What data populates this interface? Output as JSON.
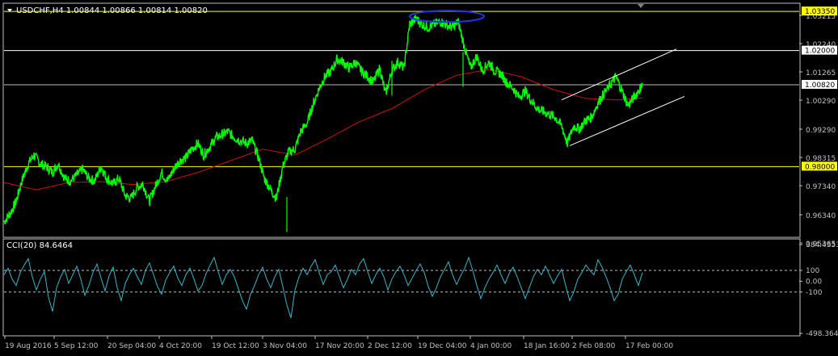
{
  "chart_data": [
    {
      "type": "candlestick-line",
      "title": "USDCHF,H4  1.00844 1.00866 1.00814 1.00820",
      "x_tick_labels": [
        "19 Aug 2016",
        "5 Sep 12:00",
        "20 Sep 04:00",
        "4 Oct 20:00",
        "19 Oct 12:00",
        "3 Nov 04:00",
        "17 Nov 20:00",
        "2 Dec 12:00",
        "19 Dec 04:00",
        "4 Jan 00:00",
        "18 Jan 16:00",
        "2 Feb 08:00",
        "17 Feb 00:00"
      ],
      "y_tick_labels": [
        "1.03215",
        "1.02240",
        "1.01265",
        "1.00290",
        "0.99290",
        "0.98315",
        "0.97340",
        "0.96340",
        "0.95365"
      ],
      "ylim": [
        0.95365,
        1.03215
      ],
      "price_series": {
        "name": "USDCHF",
        "color": "#00ff00",
        "x": [
          0,
          8,
          15,
          22,
          30,
          37,
          45,
          52,
          60,
          67,
          75,
          82,
          90,
          97,
          105,
          112,
          120,
          127,
          135,
          142,
          150,
          157,
          165,
          172,
          180,
          187,
          195,
          202,
          210,
          217,
          225,
          232,
          240,
          247,
          255,
          262,
          270,
          277,
          285,
          292,
          300,
          307,
          315,
          322,
          330,
          337,
          345,
          352,
          360,
          367,
          375,
          382,
          390,
          397,
          405,
          412,
          420,
          427,
          435,
          442,
          450,
          457,
          465,
          472,
          480,
          487,
          495,
          502,
          510,
          517,
          525,
          532,
          540,
          547,
          555,
          562,
          570,
          577,
          585,
          592,
          600,
          607,
          615,
          622,
          630,
          637,
          645,
          652,
          660,
          667,
          675,
          682,
          690,
          697,
          705,
          712,
          720,
          727,
          735,
          742,
          750,
          757,
          765,
          772,
          780,
          787,
          790
        ],
        "values": [
          0.961,
          0.964,
          0.968,
          0.975,
          0.981,
          0.984,
          0.981,
          0.98,
          0.978,
          0.981,
          0.976,
          0.975,
          0.977,
          0.979,
          0.976,
          0.975,
          0.98,
          0.976,
          0.974,
          0.976,
          0.97,
          0.969,
          0.973,
          0.974,
          0.968,
          0.973,
          0.978,
          0.975,
          0.979,
          0.982,
          0.983,
          0.986,
          0.988,
          0.984,
          0.987,
          0.99,
          0.991,
          0.992,
          0.99,
          0.989,
          0.988,
          0.989,
          0.983,
          0.976,
          0.972,
          0.969,
          0.98,
          0.985,
          0.986,
          0.992,
          0.995,
          1.001,
          1.007,
          1.011,
          1.013,
          1.017,
          1.016,
          1.014,
          1.016,
          1.013,
          1.011,
          1.009,
          1.014,
          1.005,
          1.013,
          1.016,
          1.014,
          1.029,
          1.031,
          1.029,
          1.028,
          1.029,
          1.03,
          1.029,
          1.028,
          1.03,
          1.021,
          1.014,
          1.018,
          1.013,
          1.016,
          1.013,
          1.012,
          1.009,
          1.007,
          1.004,
          1.006,
          1.003,
          1.0,
          0.999,
          0.998,
          0.997,
          0.994,
          0.988,
          0.994,
          0.993,
          0.996,
          0.997,
          1.002,
          1.005,
          1.008,
          1.011,
          1.006,
          1.001,
          1.004,
          1.007,
          1.008
        ]
      },
      "ma_series": {
        "name": "",
        "color": "#cc1111",
        "x": [
          0,
          40,
          80,
          120,
          160,
          200,
          240,
          280,
          320,
          360,
          400,
          440,
          480,
          520,
          560,
          600,
          640,
          680,
          720,
          760,
          790
        ],
        "values": [
          0.9745,
          0.972,
          0.9745,
          0.9748,
          0.9738,
          0.9748,
          0.978,
          0.982,
          0.986,
          0.984,
          0.9895,
          0.9955,
          1.0,
          1.0065,
          1.0115,
          1.0135,
          1.011,
          1.0065,
          1.0035,
          1.003,
          1.0037
        ]
      },
      "horizontal_levels": [
        {
          "value": 1.0335,
          "label": "1.03350",
          "color": "#ffff00"
        },
        {
          "value": 1.02,
          "label": "1.02000",
          "color": "#ffffff"
        },
        {
          "value": 1.0082,
          "label": "1.00820",
          "color": "#bbbbbb"
        },
        {
          "value": 0.98,
          "label": "0.98000",
          "color": "#ffff00"
        }
      ],
      "channel_lines": [
        {
          "x1": 690,
          "y1": 1.003,
          "x2": 832,
          "y2": 1.0205,
          "color": "#ffffff"
        },
        {
          "x1": 700,
          "y1": 0.9872,
          "x2": 842,
          "y2": 1.0042,
          "color": "#ffffff"
        }
      ],
      "ellipse_annotation": {
        "cx": 548,
        "cy": 1.0318,
        "rx": 46,
        "ry": 0.0012,
        "color": "#2233ff"
      },
      "grid": false
    },
    {
      "type": "line",
      "title": "CCI(20) 84.6464",
      "y_tick_labels": [
        "384.4353",
        "100",
        "0.00",
        "-100",
        "-498.3641"
      ],
      "ylim": [
        -498.3641,
        384.4353
      ],
      "reference_levels": [
        100,
        -100
      ],
      "series": [
        {
          "name": "CCI(20)",
          "color": "#38b6c8",
          "values": [
            60,
            120,
            20,
            -40,
            80,
            150,
            210,
            40,
            -80,
            20,
            90,
            -150,
            -280,
            -60,
            40,
            110,
            -20,
            60,
            140,
            20,
            -130,
            -40,
            80,
            160,
            30,
            -90,
            50,
            130,
            -60,
            -180,
            -20,
            60,
            120,
            40,
            -30,
            100,
            170,
            60,
            -50,
            -120,
            10,
            80,
            140,
            30,
            -40,
            60,
            120,
            20,
            -90,
            -40,
            70,
            150,
            220,
            90,
            -30,
            60,
            110,
            40,
            -70,
            -180,
            -260,
            -120,
            -40,
            60,
            130,
            20,
            -60,
            40,
            110,
            -50,
            -220,
            -340,
            -80,
            40,
            120,
            60,
            140,
            200,
            80,
            -30,
            60,
            90,
            150,
            40,
            -60,
            20,
            110,
            60,
            160,
            210,
            90,
            -20,
            60,
            120,
            40,
            -80,
            20,
            90,
            140,
            60,
            -40,
            30,
            100,
            160,
            80,
            -50,
            -140,
            -60,
            40,
            110,
            180,
            60,
            -30,
            50,
            120,
            220,
            100,
            -40,
            -160,
            -60,
            20,
            80,
            150,
            60,
            -20,
            70,
            130,
            40,
            -60,
            -160,
            -60,
            40,
            110,
            60,
            140,
            60,
            -20,
            50,
            110,
            -40,
            -180,
            -100,
            20,
            80,
            150,
            100,
            60,
            200,
            130,
            40,
            -60,
            -180,
            -120,
            20,
            90,
            150,
            60,
            -40,
            80
          ]
        }
      ],
      "grid": false
    }
  ]
}
